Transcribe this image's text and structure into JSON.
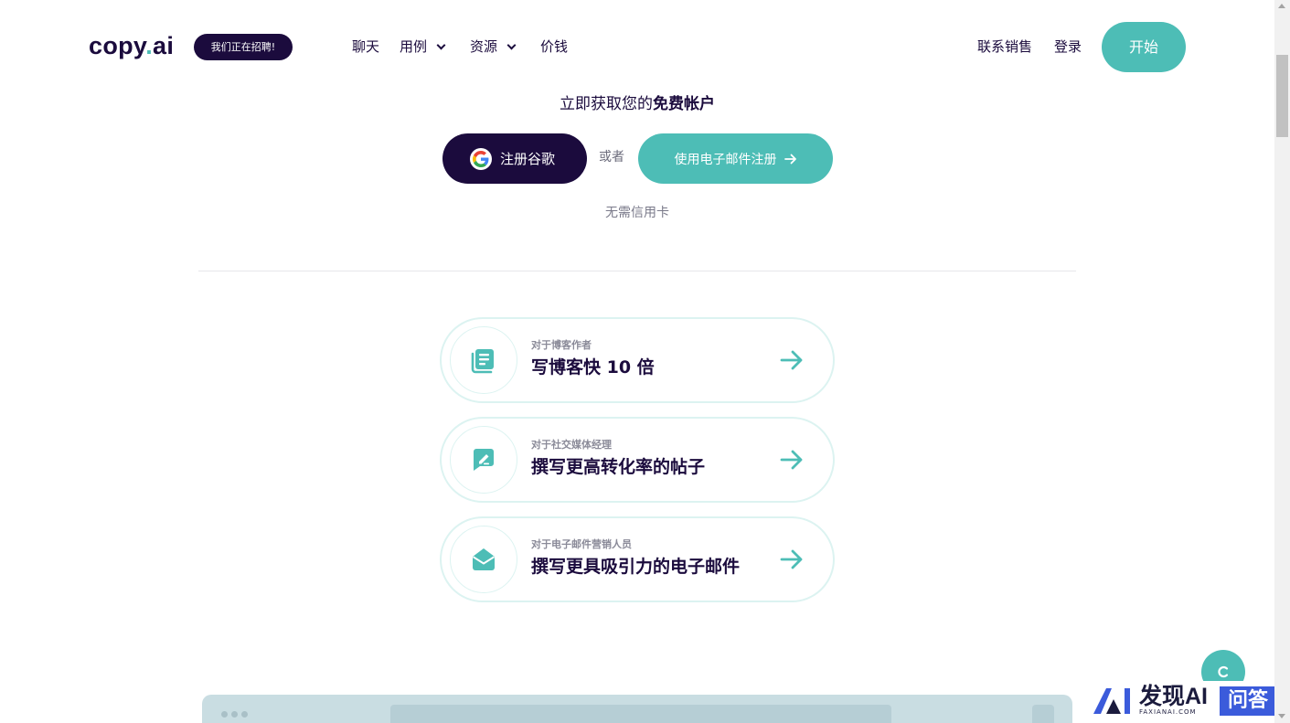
{
  "header": {
    "logo": {
      "main": "copy",
      "dot": ".",
      "suffix": "ai"
    },
    "hiring_badge": "我们正在招聘!",
    "nav": [
      {
        "label": "聊天",
        "dropdown": false
      },
      {
        "label": "用例",
        "dropdown": true
      },
      {
        "label": "资源",
        "dropdown": true
      },
      {
        "label": "价钱",
        "dropdown": false
      }
    ],
    "contact_sales": "联系销售",
    "login": "登录",
    "start": "开始"
  },
  "signup": {
    "title_prefix": "立即获取您的",
    "title_bold": "免费帐户",
    "google_label": "注册谷歌",
    "or": "或者",
    "email_label": "使用电子邮件注册",
    "no_credit_card": "无需信用卡"
  },
  "cards": [
    {
      "icon": "document-icon",
      "subtitle": "对于博客作者",
      "title": "写博客快 10 倍"
    },
    {
      "icon": "edit-message-icon",
      "subtitle": "对于社交媒体经理",
      "title": "撰写更高转化率的帖子"
    },
    {
      "icon": "envelope-icon",
      "subtitle": "对于电子邮件营销人员",
      "title": "撰写更具吸引力的电子邮件"
    }
  ],
  "watermark": {
    "text": "发现AI",
    "sub": "FAXIANAI.COM",
    "badge": "问答"
  },
  "colors": {
    "brand_dark": "#1b0b3d",
    "accent_teal": "#4dbdb6",
    "card_border": "#dcf3f1",
    "watermark_blue": "#3b5bdb"
  }
}
